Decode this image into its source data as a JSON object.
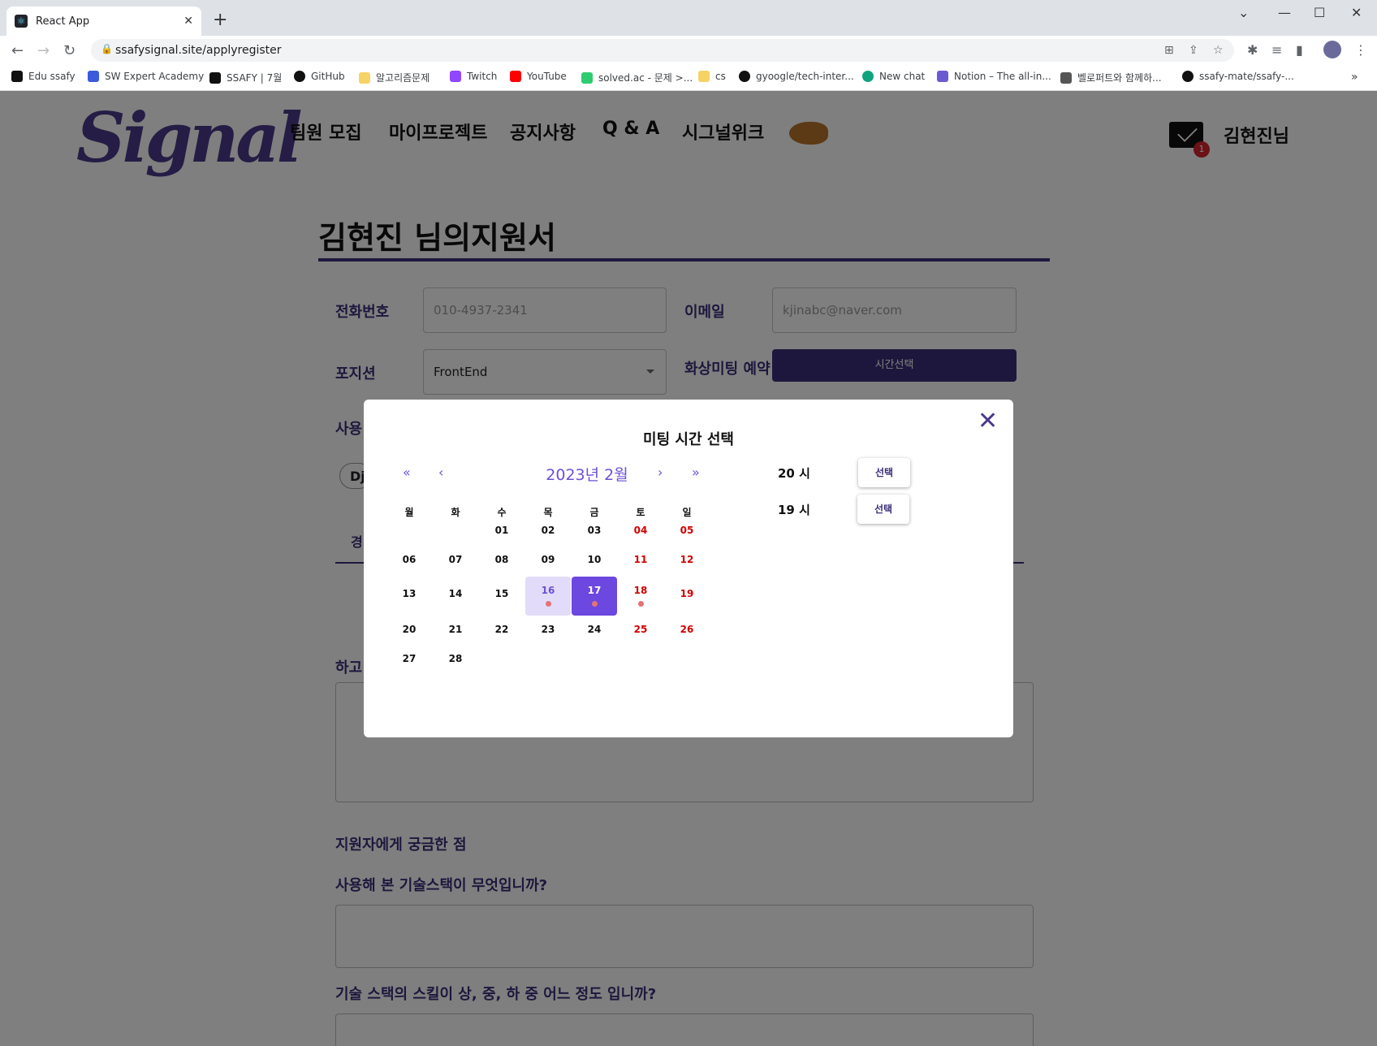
{
  "browser": {
    "tab_title": "React App",
    "url": "ssafysignal.site/applyregister",
    "bookmarks": [
      "Edu ssafy",
      "SW Expert Academy",
      "SSAFY | 7월",
      "GitHub",
      "알고리즘문제",
      "Twitch",
      "YouTube",
      "solved.ac - 문제 >...",
      "cs",
      "gyoogle/tech-inter...",
      "New chat",
      "Notion – The all-in...",
      "벨로퍼트와 함께하...",
      "ssafy-mate/ssafy-..."
    ],
    "bookmark_colors": [
      "#111111",
      "#3b5bdb",
      "#111111",
      "#111111",
      "#f6d365",
      "#9146ff",
      "#ff0000",
      "#2ecc71",
      "#f6d365",
      "#111111",
      "#10a37f",
      "#6b5bd3",
      "#555555",
      "#111111"
    ]
  },
  "header": {
    "logo": "Signal",
    "nav": [
      "팀원 모집",
      "마이프로젝트",
      "공지사항",
      "Q & A",
      "시그널위크"
    ],
    "mail_badge": "1",
    "user": "김현진님"
  },
  "form": {
    "title": "김현진 님의지원서",
    "phone_label": "전화번호",
    "phone_placeholder": "010-4937-2341",
    "email_label": "이메일",
    "email_placeholder": "kjinabc@naver.com",
    "position_label": "포지션",
    "position_value": "FrontEnd",
    "meeting_label": "화상미팅 예약",
    "meeting_button": "시간선택",
    "stack_label_partial": "사용",
    "chip_partial": "Dj",
    "tab_partial": "경",
    "want_label_partial": "하고",
    "questions_heading": "지원자에게 궁금한 점",
    "question1": "사용해 본 기술스택이 무엇입니까?",
    "question2": "기술 스택의 스킬이 상, 중, 하 중 어느 정도 입니까?"
  },
  "modal": {
    "title": "미팅 시간 선택",
    "close_icon": "close-icon",
    "month": "2023년 2월",
    "nav": {
      "prev_year": "«",
      "prev_month": "‹",
      "next_month": "›",
      "next_year": "»"
    },
    "weekdays": [
      "월",
      "화",
      "수",
      "목",
      "금",
      "토",
      "일"
    ],
    "weeks": [
      [
        "",
        "",
        "01",
        "02",
        "03",
        "04",
        "05"
      ],
      [
        "06",
        "07",
        "08",
        "09",
        "10",
        "11",
        "12"
      ],
      [
        "13",
        "14",
        "15",
        "16",
        "17",
        "18",
        "19"
      ],
      [
        "20",
        "21",
        "22",
        "23",
        "24",
        "25",
        "26"
      ],
      [
        "27",
        "28",
        "",
        "",
        "",
        "",
        ""
      ]
    ],
    "highlighted_day": "16",
    "selected_day": "17",
    "days_with_dot": [
      "16",
      "17",
      "18"
    ],
    "slots": [
      {
        "time": "20 시",
        "button": "선택"
      },
      {
        "time": "19 시",
        "button": "선택"
      }
    ],
    "colors": {
      "accent": "#6c47e0",
      "weekend": "#d10000",
      "dot": "#e57373",
      "brand": "#3c2f7a"
    }
  }
}
